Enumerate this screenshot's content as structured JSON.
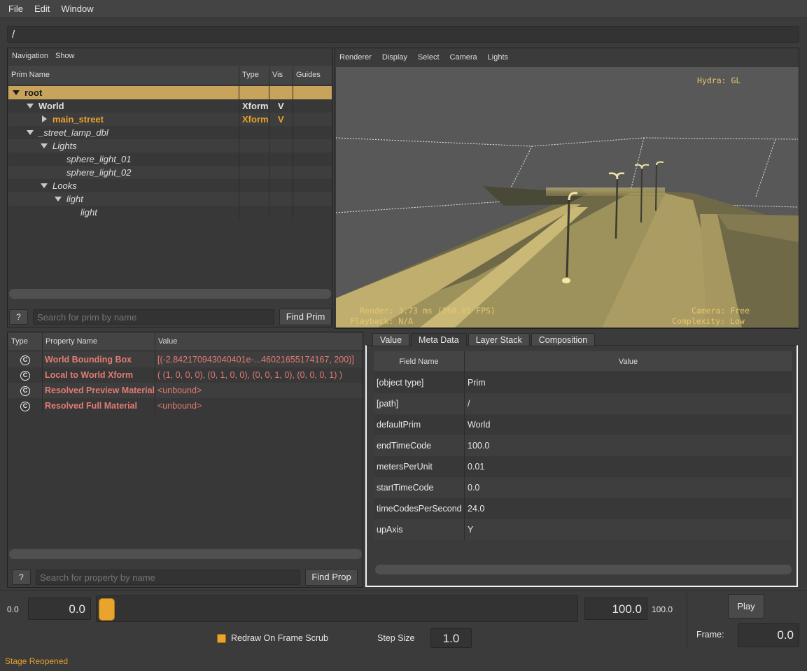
{
  "menu": {
    "items": [
      "File",
      "Edit",
      "Window"
    ]
  },
  "path": "/",
  "navigation": {
    "menu": [
      "Navigation",
      "Show"
    ],
    "columns": [
      "Prim Name",
      "Type",
      "Vis",
      "Guides"
    ],
    "rows": [
      {
        "name": "root",
        "type": "",
        "vis": ""
      },
      {
        "name": "World",
        "type": "Xform",
        "vis": "V"
      },
      {
        "name": "main_street",
        "type": "Xform",
        "vis": "V"
      },
      {
        "name": "_street_lamp_dbl",
        "type": "",
        "vis": ""
      },
      {
        "name": "Lights",
        "type": "",
        "vis": ""
      },
      {
        "name": "sphere_light_01",
        "type": "",
        "vis": ""
      },
      {
        "name": "sphere_light_02",
        "type": "",
        "vis": ""
      },
      {
        "name": "Looks",
        "type": "",
        "vis": ""
      },
      {
        "name": "light",
        "type": "",
        "vis": ""
      },
      {
        "name": "light",
        "type": "",
        "vis": ""
      }
    ],
    "help_label": "?",
    "search_placeholder": "Search for prim by name",
    "find_label": "Find Prim"
  },
  "viewport": {
    "menu": [
      "Renderer",
      "Display",
      "Select",
      "Camera",
      "Lights"
    ],
    "hud_renderer": "Hydra: GL",
    "hud_render": "Render: 3.73 ms (268.05 FPS)",
    "hud_playback": "Playback: N/A",
    "hud_camera": "Camera: Free",
    "hud_complexity": "Complexity: Low",
    "colors": {
      "ground": "#b5a468",
      "light": "#f5e7a8"
    }
  },
  "properties": {
    "columns": [
      "Type",
      "Property Name",
      "Value"
    ],
    "rows": [
      {
        "icon": "C",
        "name": "World Bounding Box",
        "value": "[(-2.842170943040401e-...46021655174167, 200)]"
      },
      {
        "icon": "C",
        "name": "Local to World Xform",
        "value": "( (1, 0, 0, 0), (0, 1, 0, 0), (0, 0, 1, 0), (0, 0, 0, 1) )"
      },
      {
        "icon": "C",
        "name": "Resolved Preview Material",
        "value": "<unbound>"
      },
      {
        "icon": "C",
        "name": "Resolved Full Material",
        "value": "<unbound>"
      }
    ],
    "help_label": "?",
    "search_placeholder": "Search for property by name",
    "find_label": "Find Prop"
  },
  "metadata": {
    "tabs": [
      "Value",
      "Meta Data",
      "Layer Stack",
      "Composition"
    ],
    "active_tab": "Meta Data",
    "columns": [
      "Field Name",
      "Value"
    ],
    "rows": [
      {
        "field": "[object type]",
        "value": "Prim"
      },
      {
        "field": "[path]",
        "value": "/"
      },
      {
        "field": "defaultPrim",
        "value": "World"
      },
      {
        "field": "endTimeCode",
        "value": "100.0"
      },
      {
        "field": "metersPerUnit",
        "value": "0.01"
      },
      {
        "field": "startTimeCode",
        "value": "0.0"
      },
      {
        "field": "timeCodesPerSecond",
        "value": "24.0"
      },
      {
        "field": "upAxis",
        "value": "Y"
      }
    ]
  },
  "timeline": {
    "range_start_label": "0.0",
    "start_value": "0.0",
    "end_value": "100.0",
    "range_end_label": "100.0",
    "redraw_label": "Redraw On Frame Scrub",
    "redraw_checked": true,
    "step_size_label": "Step Size",
    "step_size_value": "1.0",
    "play_label": "Play",
    "frame_label": "Frame:",
    "frame_value": "0.0"
  },
  "status": "Stage Reopened"
}
